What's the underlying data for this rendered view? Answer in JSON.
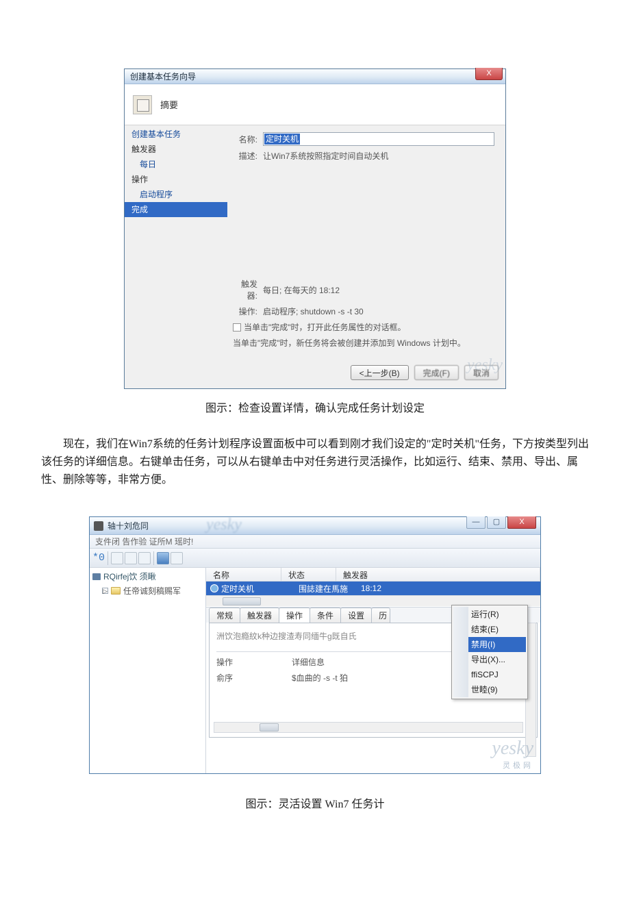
{
  "wizard": {
    "titlebar": "创建基本任务向导",
    "close_x": "X",
    "header_title": "摘要",
    "sidebar": {
      "create": "创建基本任务",
      "trigger_root": "触发器",
      "trigger_daily": "每日",
      "action_root": "操作",
      "action_prog": "启动程序",
      "finish": "完成"
    },
    "labels": {
      "name": "名称:",
      "desc": "描述:",
      "trigger": "触发器:",
      "action": "操作:"
    },
    "values": {
      "name": "定时关机",
      "desc": "让Win7系统按照指定时间自动关机",
      "trigger": "每日; 在每天的 18:12",
      "action": "启动程序; shutdown -s -t 30"
    },
    "checkbox_text": "当单击\"完成\"时，打开此任务属性的对话框。",
    "note": "当单击\"完成\"时，新任务将会被创建并添加到 Windows 计划中。",
    "buttons": {
      "back": "<上一步(B)",
      "finish": "完成(F)",
      "cancel": "取消"
    },
    "watermark": "yesky"
  },
  "caption1": "图示：检查设置详情，确认完成任务计划设定",
  "paragraph": "现在，我们在Win7系统的任务计划程序设置面板中可以看到刚才我们设定的\"定时关机\"任务，下方按类型列出该任务的详细信息。右键单击任务，可以从右键单击中对任务进行灵活操作，比如运行、结束、禁用、导出、属性、删除等等，非常方便。",
  "scheduler": {
    "title": "轴十刘危同",
    "title_wm": "yesky",
    "menubar": "支件闭 告作验        证所M 瑶时!",
    "toolbar_prefix": "*0",
    "tree": {
      "root": "RQirfej饮  须瞅",
      "child": "任帝诚刻稿赐军"
    },
    "list": {
      "col_name": "名称",
      "col_status": "状态",
      "col_trigger": "触发器",
      "row_name": "定时关机",
      "row_status": "围誌建在馬施",
      "row_trigger": "18:12"
    },
    "tabs": {
      "general": "常规",
      "triggers": "触发器",
      "actions": "操作",
      "conditions": "条件",
      "settings": "设置",
      "history": "历"
    },
    "tab_desc": "洲饮泡瘾紋k种边搜渣寿同缅牛g既自氏",
    "action_col1": "操作",
    "action_col2": "详细信息",
    "action_row1": "俞序",
    "action_row2": "$血曲的 -s -t 狛",
    "context": {
      "run": "运行(R)",
      "end": "结束(E)",
      "disable": "禁用(I)",
      "export": "导出(X)...",
      "ffi": "ffiSCPJ",
      "shi": "世睦(9)"
    },
    "watermark": "yesky",
    "watermark_sub": "灵极网"
  },
  "caption2": "图示：灵活设置 Win7 任务计"
}
